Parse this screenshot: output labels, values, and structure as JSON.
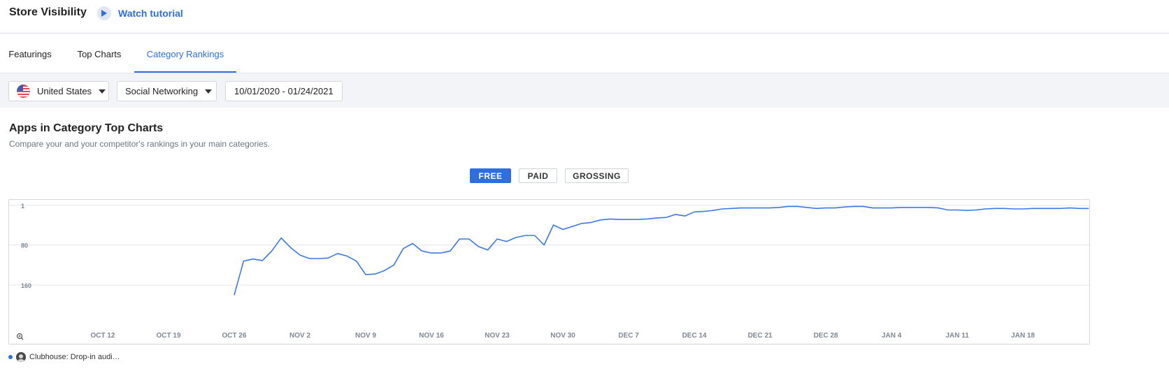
{
  "header": {
    "title": "Store Visibility",
    "tutorial_label": "Watch tutorial"
  },
  "tabs": [
    {
      "label": "Featurings"
    },
    {
      "label": "Top Charts"
    },
    {
      "label": "Category Rankings",
      "active": true
    }
  ],
  "filters": {
    "country": "United States",
    "category": "Social Networking",
    "date_range": "10/01/2020 - 01/24/2021"
  },
  "section": {
    "title": "Apps in Category Top Charts",
    "subtitle": "Compare your and your competitor's rankings in your main categories."
  },
  "chart_type_buttons": [
    {
      "label": "FREE",
      "active": true
    },
    {
      "label": "PAID"
    },
    {
      "label": "GROSSING"
    }
  ],
  "colors": {
    "accent": "#2d6fde",
    "series": "#3b78e7",
    "grid": "#e3e6ea",
    "filter_bg": "#f2f4f7"
  },
  "legend": {
    "app_name": "Clubhouse: Drop-in audi…"
  },
  "chart_data": {
    "type": "line",
    "title": "",
    "xlabel": "",
    "ylabel": "",
    "y_axis": "rank (inverted, 1 at top)",
    "ylim": [
      1,
      240
    ],
    "y_ticks": [
      "1",
      "80",
      "160"
    ],
    "x_ticks": [
      "OCT 12",
      "OCT 19",
      "OCT 26",
      "NOV 2",
      "NOV 9",
      "NOV 16",
      "NOV 23",
      "NOV 30",
      "DEC 7",
      "DEC 14",
      "DEC 21",
      "DEC 28",
      "JAN 4",
      "JAN 11",
      "JAN 18"
    ],
    "x_tick_dates": [
      "2020-10-12",
      "2020-10-19",
      "2020-10-26",
      "2020-11-02",
      "2020-11-09",
      "2020-11-16",
      "2020-11-23",
      "2020-11-30",
      "2020-12-07",
      "2020-12-14",
      "2020-12-21",
      "2020-12-28",
      "2021-01-04",
      "2021-01-11",
      "2021-01-18"
    ],
    "series": [
      {
        "values": [
          {
            "x": "2020-10-26",
            "y": 180
          },
          {
            "x": "2020-10-27",
            "y": 112
          },
          {
            "x": "2020-10-28",
            "y": 108
          },
          {
            "x": "2020-10-29",
            "y": 111
          },
          {
            "x": "2020-10-30",
            "y": 92
          },
          {
            "x": "2020-10-31",
            "y": 66
          },
          {
            "x": "2020-11-01",
            "y": 85
          },
          {
            "x": "2020-11-02",
            "y": 100
          },
          {
            "x": "2020-11-03",
            "y": 107
          },
          {
            "x": "2020-11-04",
            "y": 107
          },
          {
            "x": "2020-11-05",
            "y": 106
          },
          {
            "x": "2020-11-06",
            "y": 97
          },
          {
            "x": "2020-11-07",
            "y": 102
          },
          {
            "x": "2020-11-08",
            "y": 112
          },
          {
            "x": "2020-11-09",
            "y": 139
          },
          {
            "x": "2020-11-10",
            "y": 138
          },
          {
            "x": "2020-11-11",
            "y": 131
          },
          {
            "x": "2020-11-12",
            "y": 120
          },
          {
            "x": "2020-11-13",
            "y": 87
          },
          {
            "x": "2020-11-14",
            "y": 77
          },
          {
            "x": "2020-11-15",
            "y": 92
          },
          {
            "x": "2020-11-16",
            "y": 96
          },
          {
            "x": "2020-11-17",
            "y": 96
          },
          {
            "x": "2020-11-18",
            "y": 92
          },
          {
            "x": "2020-11-19",
            "y": 68
          },
          {
            "x": "2020-11-20",
            "y": 68
          },
          {
            "x": "2020-11-21",
            "y": 83
          },
          {
            "x": "2020-11-22",
            "y": 90
          },
          {
            "x": "2020-11-23",
            "y": 68
          },
          {
            "x": "2020-11-24",
            "y": 73
          },
          {
            "x": "2020-11-25",
            "y": 65
          },
          {
            "x": "2020-11-26",
            "y": 61
          },
          {
            "x": "2020-11-27",
            "y": 61
          },
          {
            "x": "2020-11-28",
            "y": 80
          },
          {
            "x": "2020-11-29",
            "y": 40
          },
          {
            "x": "2020-11-30",
            "y": 49
          },
          {
            "x": "2020-12-01",
            "y": 43
          },
          {
            "x": "2020-12-02",
            "y": 37
          },
          {
            "x": "2020-12-03",
            "y": 35
          },
          {
            "x": "2020-12-04",
            "y": 30
          },
          {
            "x": "2020-12-05",
            "y": 28
          },
          {
            "x": "2020-12-06",
            "y": 29
          },
          {
            "x": "2020-12-07",
            "y": 29
          },
          {
            "x": "2020-12-08",
            "y": 29
          },
          {
            "x": "2020-12-09",
            "y": 28
          },
          {
            "x": "2020-12-10",
            "y": 26
          },
          {
            "x": "2020-12-11",
            "y": 25
          },
          {
            "x": "2020-12-12",
            "y": 19
          },
          {
            "x": "2020-12-13",
            "y": 22
          },
          {
            "x": "2020-12-14",
            "y": 14
          },
          {
            "x": "2020-12-15",
            "y": 13
          },
          {
            "x": "2020-12-16",
            "y": 11
          },
          {
            "x": "2020-12-17",
            "y": 8
          },
          {
            "x": "2020-12-18",
            "y": 7
          },
          {
            "x": "2020-12-19",
            "y": 6
          },
          {
            "x": "2020-12-20",
            "y": 6
          },
          {
            "x": "2020-12-21",
            "y": 6
          },
          {
            "x": "2020-12-22",
            "y": 6
          },
          {
            "x": "2020-12-23",
            "y": 5
          },
          {
            "x": "2020-12-24",
            "y": 3
          },
          {
            "x": "2020-12-25",
            "y": 3
          },
          {
            "x": "2020-12-26",
            "y": 5
          },
          {
            "x": "2020-12-27",
            "y": 7
          },
          {
            "x": "2020-12-28",
            "y": 6
          },
          {
            "x": "2020-12-29",
            "y": 6
          },
          {
            "x": "2020-12-30",
            "y": 4
          },
          {
            "x": "2020-12-31",
            "y": 3
          },
          {
            "x": "2021-01-01",
            "y": 3
          },
          {
            "x": "2021-01-02",
            "y": 6
          },
          {
            "x": "2021-01-03",
            "y": 6
          },
          {
            "x": "2021-01-04",
            "y": 6
          },
          {
            "x": "2021-01-05",
            "y": 5
          },
          {
            "x": "2021-01-06",
            "y": 5
          },
          {
            "x": "2021-01-07",
            "y": 5
          },
          {
            "x": "2021-01-08",
            "y": 5
          },
          {
            "x": "2021-01-09",
            "y": 6
          },
          {
            "x": "2021-01-10",
            "y": 10
          },
          {
            "x": "2021-01-11",
            "y": 10
          },
          {
            "x": "2021-01-12",
            "y": 11
          },
          {
            "x": "2021-01-13",
            "y": 10
          },
          {
            "x": "2021-01-14",
            "y": 8
          },
          {
            "x": "2021-01-15",
            "y": 7
          },
          {
            "x": "2021-01-16",
            "y": 7
          },
          {
            "x": "2021-01-17",
            "y": 8
          },
          {
            "x": "2021-01-18",
            "y": 8
          },
          {
            "x": "2021-01-19",
            "y": 7
          },
          {
            "x": "2021-01-20",
            "y": 7
          },
          {
            "x": "2021-01-21",
            "y": 7
          },
          {
            "x": "2021-01-22",
            "y": 7
          },
          {
            "x": "2021-01-23",
            "y": 6
          },
          {
            "x": "2021-01-24",
            "y": 7
          },
          {
            "x": "2021-01-25",
            "y": 7
          }
        ]
      }
    ],
    "grid": true,
    "legend_position": "bottom-left"
  }
}
